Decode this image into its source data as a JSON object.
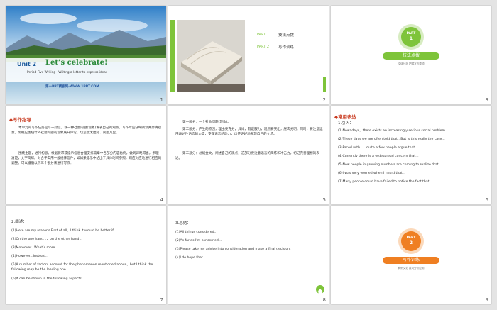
{
  "colors": {
    "green": "#7ec43a",
    "orange": "#ef7f22",
    "red": "#c8381d",
    "title_blue": "#1a5a9b"
  },
  "slides": [
    {
      "number": "1",
      "unit": "Unit 2",
      "title": "Let’s celebrate!",
      "period": "Period Five   Writing—Writing a letter to express ideas",
      "site": "第一PPT模板网-WWW.1PPT.COM"
    },
    {
      "number": "2",
      "parts": [
        {
          "label": "PART 1",
          "text": "技法点拨"
        },
        {
          "label": "PART 2",
          "text": "写作训练"
        }
      ]
    },
    {
      "number": "3",
      "badge_top": "PART",
      "badge_num": "1",
      "pill": "技法点拨",
      "subtitle": "文体分析   把握写作要领"
    },
    {
      "number": "4",
      "heading": "◆写作指导",
      "paragraphs": [
        "本单元的写作任务是写一封信，就一种社会问题(现象)发表自己的观点。写作时应仔细阅读并弄清题意，明确应围绕什么社会问题或现象展开评论，切忌漫无边际、离题万里。",
        "围绕主题，进行构思。根据要求或提示信息合理安排篇章中各部分内容比例，做到详略得当，条理清楚，文字简练。对合乎实用一般规律信件，如如果提示中给出了具体时间参照，则应对应地进行相应的调整。可以遵循以下三个部分来进行写作："
      ]
    },
    {
      "number": "5",
      "paragraphs": [
        "第一部分：一个社会问题(现象)。",
        "第二部分：产生的原因，理由要充分，具体，有说服力，观点要突出，层次分明。同时，要注意运用表达性语言的力度，支撑语言的动力，以使更好地表现自己的立场。",
        "第三部分：总结全文。阐述自己的观点，这部分要注意语言的简练和冲击力，切记完善理想的表达。"
      ]
    },
    {
      "number": "6",
      "heading": "◆常用表达",
      "intro": "1.引入：",
      "items": [
        "(1)Nowadays，there exists an increasingly serious social problem...",
        "(2)These days we are often told that...But is this really the case...",
        "(3)Faced with...，quite a few people argue that...",
        "(4)Currently there is a widespread concern that...",
        "(5)Now people in growing numbers are coming to realize that...",
        "(6)I was very worried when I heard that...",
        "(7)Many people could have failed to notice the fact that..."
      ]
    },
    {
      "number": "7",
      "intro": "2.阐述：",
      "items": [
        "(1)Here are my reasons.First of all，I think it would be better if...",
        "(2)On the one hand...，on the other hand...",
        "(3)Moreover...What’s more...",
        "(4)However...Instead...",
        "(5)A number of factors account for the phenomenon mentioned above，but I think the following may be the leading one...",
        "(6)It can be shown in the following aspects..."
      ]
    },
    {
      "number": "8",
      "intro": "3.总结：",
      "items": [
        "(1)All things considered...",
        "(2)As far as I’m concerned...",
        "(3)Please take my advice into consideration and make a final decision.",
        "(4)I do hope that..."
      ]
    },
    {
      "number": "9",
      "badge_top": "PART",
      "badge_num": "2",
      "pill": "写作训练",
      "subtitle": "典例文范   技巧分析应用"
    }
  ]
}
